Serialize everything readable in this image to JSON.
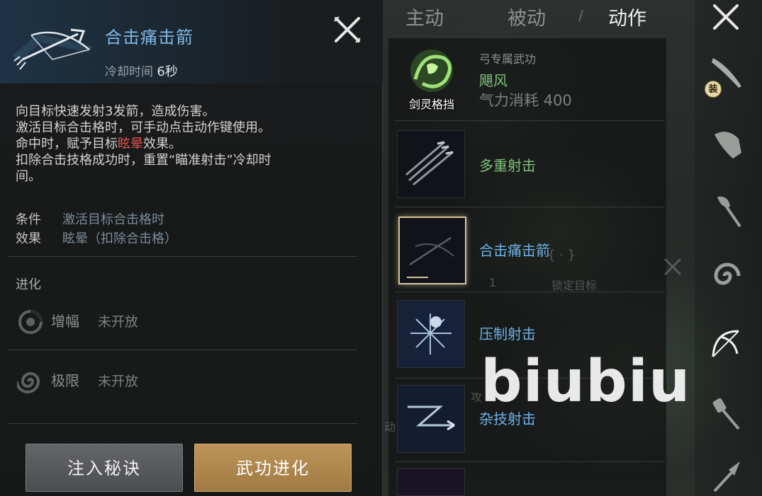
{
  "detail": {
    "title": "合击痛击箭",
    "cooldown_label": "冷却时间",
    "cooldown_value": "6秒",
    "desc_line1": "向目标快速发射3发箭，造成伤害。",
    "desc_line2": "激活目标合击格时，可手动点击动作键使用。",
    "desc_line3_pre": "命中时，赋予目标",
    "desc_line3_red": "眩晕",
    "desc_line3_post": "效果。",
    "desc_line4": "扣除合击技格成功时，重置“瞄准射击”冷却时",
    "desc_line5": "间。",
    "condition_key": "条件",
    "condition_value": "激活目标合击格时",
    "effect_key": "效果",
    "effect_value": "眩晕（扣除合击格）",
    "evolution_title": "进化",
    "evolutions": [
      {
        "name": "增幅",
        "state": "未开放",
        "icon": "swirl-icon"
      },
      {
        "name": "极限",
        "state": "未开放",
        "icon": "spiral-icon"
      }
    ],
    "btn_inject": "注入秘诀",
    "btn_evolve": "武功进化"
  },
  "tabs": {
    "active_skill": "主动",
    "passive_skill": "被动",
    "action": "动作",
    "separator": "/"
  },
  "skill_list": {
    "weapon_label": "弓专属武功",
    "weapon_skill": "飓风",
    "stamina_label": "气力消耗",
    "stamina_value": "400",
    "parry_label": "剑灵格挡",
    "items": [
      {
        "name": "多重射击",
        "color": "#7ec07a"
      },
      {
        "name": "合击痛击箭",
        "color": "#6db1e6",
        "selected": true
      },
      {
        "name": "压制射击",
        "color": "#6db1e6"
      },
      {
        "name": "杂技射击",
        "color": "#6db1e6"
      }
    ],
    "ghost_lock_target": "锁定目标",
    "ghost_number": "1",
    "ghost_brackets": "{ · }",
    "ghost_gong": "攻",
    "ghost_dong": "动"
  },
  "weapons": {
    "equip_badge": "装",
    "icons": [
      "sword-icon",
      "gauntlet-icon",
      "axe-icon",
      "spiral-orb-icon",
      "bow-icon",
      "mace-icon",
      "spear-icon"
    ]
  },
  "watermark": "biubiu"
}
